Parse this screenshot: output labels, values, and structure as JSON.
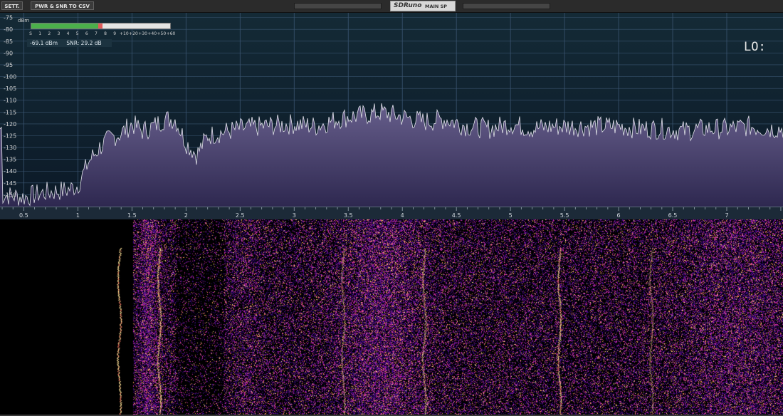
{
  "titlebar": {
    "sett_label": "SETT.",
    "csv_label": "PWR & SNR TO CSV",
    "brand_logo": "SDRuno",
    "window_title": "MAIN SP"
  },
  "meter": {
    "unit": "dBm",
    "scale_labels": [
      "S",
      "1",
      "2",
      "3",
      "4",
      "5",
      "6",
      "7",
      "8",
      "9",
      "+10",
      "+20",
      "+30",
      "+40",
      "+50",
      "+60"
    ],
    "fill_fraction": 0.48,
    "colors": {
      "fill": "#4bb04b",
      "peak": "#e05a5a",
      "track": "#e4e4e4"
    }
  },
  "readout": {
    "power": "-69.1 dBm",
    "snr": "SNR: 29.2 dB"
  },
  "lo_label": "LO:",
  "chart_data": {
    "type": "line",
    "title": "",
    "xlabel": "",
    "ylabel": "dBm",
    "x_ticks": [
      "0.5",
      "1",
      "1.5",
      "2",
      "2.5",
      "3",
      "3.5",
      "4",
      "4.5",
      "5",
      "5.5",
      "6",
      "6.5",
      "7"
    ],
    "y_ticks": [
      "-75",
      "-80",
      "-85",
      "-90",
      "-95",
      "-100",
      "-105",
      "-110",
      "-115",
      "-120",
      "-125",
      "-130",
      "-135",
      "-140",
      "-145",
      "-150"
    ],
    "xlim": [
      0.28,
      7.52
    ],
    "ylim": [
      -155,
      -73
    ],
    "series": [
      {
        "x": [
          0.3,
          0.5,
          0.7,
          0.9,
          1.0,
          1.1,
          1.2,
          1.3,
          1.4,
          1.5,
          1.6,
          1.7,
          1.8,
          1.9,
          2.0,
          2.1,
          2.2,
          2.3,
          2.5,
          2.7,
          3.0,
          3.2,
          3.4,
          3.5,
          3.7,
          3.8,
          4.0,
          4.2,
          4.4,
          4.6,
          4.8,
          5.0,
          5.2,
          5.4,
          5.6,
          5.8,
          6.0,
          6.2,
          6.4,
          6.6,
          6.8,
          7.0,
          7.2,
          7.4,
          7.5
        ],
        "values": [
          -150,
          -151,
          -149,
          -148,
          -146,
          -136,
          -130,
          -126,
          -124,
          -120,
          -123,
          -121,
          -118,
          -118,
          -128,
          -133,
          -125,
          -124,
          -122,
          -121,
          -120,
          -121,
          -118,
          -117,
          -116,
          -115,
          -117,
          -119,
          -118,
          -121,
          -122,
          -120,
          -122,
          -121,
          -121,
          -121,
          -121,
          -122,
          -122,
          -123,
          -122,
          -122,
          -121,
          -122,
          -122
        ]
      }
    ],
    "colors": {
      "fill_top": "#675f8c",
      "fill_bottom": "#2e2850",
      "trace": "#e2e2ea",
      "grid": "#3a5470"
    }
  }
}
